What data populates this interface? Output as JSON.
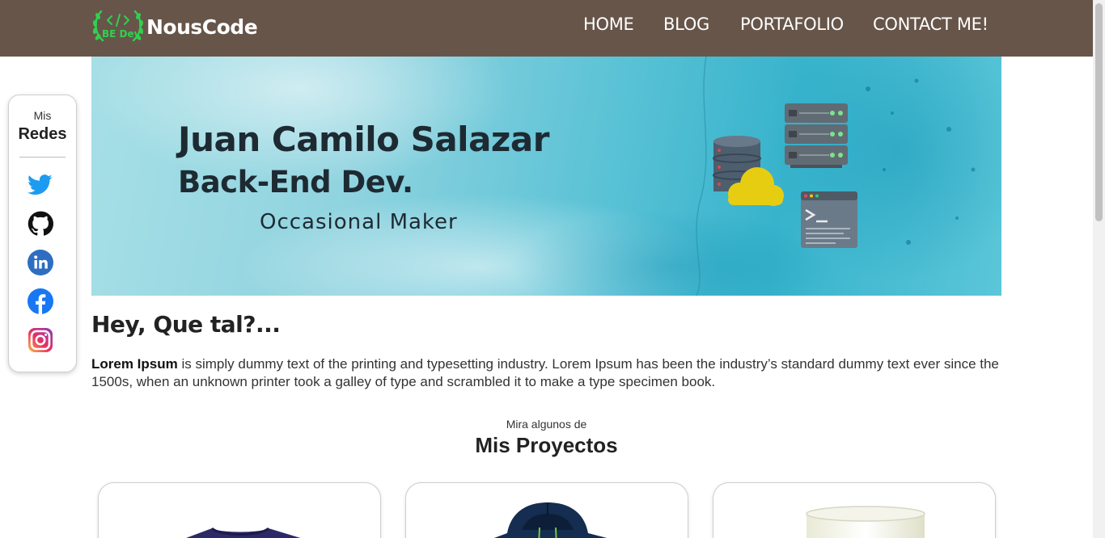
{
  "header": {
    "logo_badge": "BE Dev",
    "logo_text": "NousCode",
    "nav": [
      {
        "label": "HOME"
      },
      {
        "label": "BLOG"
      },
      {
        "label": "PORTAFOLIO"
      },
      {
        "label": "CONTACT ME!"
      }
    ]
  },
  "social": {
    "small": "Mis",
    "big": "Redes",
    "icons": [
      "twitter-icon",
      "github-icon",
      "linkedin-icon",
      "facebook-icon",
      "instagram-icon"
    ]
  },
  "banner": {
    "name": "Juan Camilo Salazar",
    "role": "Back-End Dev.",
    "subtitle": "Occasional Maker"
  },
  "intro": {
    "heading": "Hey, Que tal?...",
    "bold": "Lorem Ipsum",
    "text": " is simply dummy text of the printing and typesetting industry. Lorem Ipsum has been the industry’s standard dummy text ever since the 1500s, when an unknown printer took a galley of type and scrambled it to make a type specimen book."
  },
  "projects": {
    "small": "Mira algunos de",
    "title": "Mis Proyectos",
    "cards": [
      {
        "image": "t-shirt"
      },
      {
        "image": "hoodie"
      },
      {
        "image": "mug"
      }
    ]
  },
  "colors": {
    "header_bg": "#67554a",
    "logo_green": "#2fd14f",
    "text_dark": "#222222"
  }
}
